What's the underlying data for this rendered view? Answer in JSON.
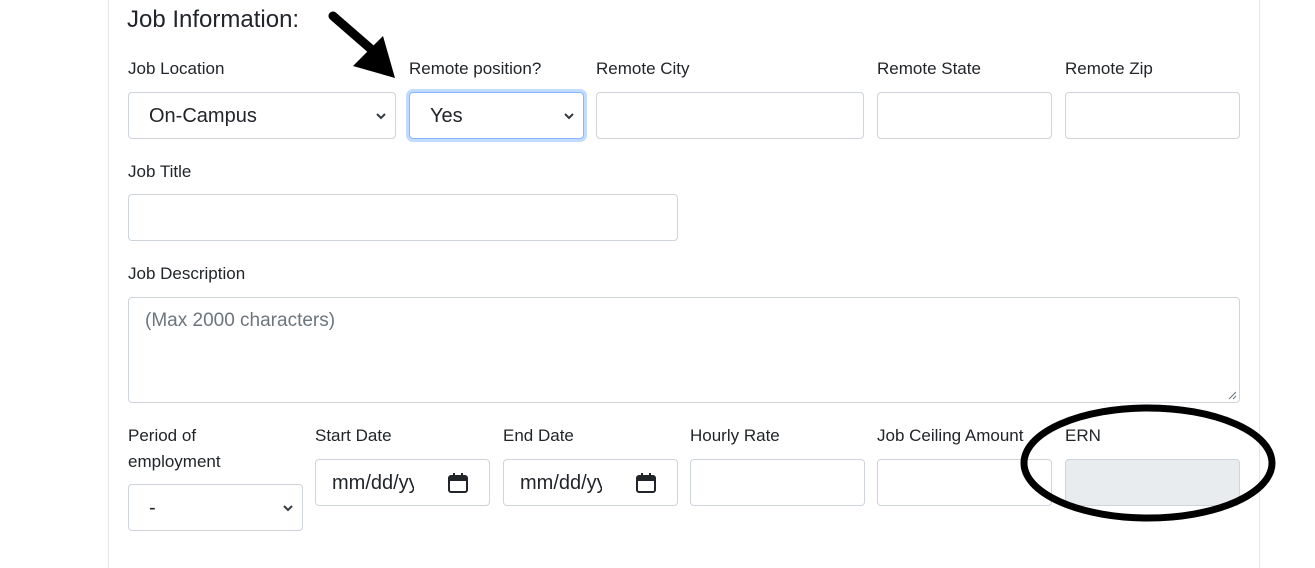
{
  "section": {
    "title": "Job Information:"
  },
  "row1": {
    "job_location": {
      "label": "Job Location",
      "value": "On-Campus"
    },
    "remote_position": {
      "label": "Remote position?",
      "value": "Yes"
    },
    "remote_city": {
      "label": "Remote City",
      "value": ""
    },
    "remote_state": {
      "label": "Remote State",
      "value": ""
    },
    "remote_zip": {
      "label": "Remote Zip",
      "value": ""
    }
  },
  "job_title": {
    "label": "Job Title",
    "value": ""
  },
  "job_description": {
    "label": "Job Description",
    "placeholder": "(Max 2000 characters)"
  },
  "row3": {
    "period": {
      "label_line1": "Period of",
      "label_line2": "employment",
      "value": "-"
    },
    "start_date": {
      "label": "Start Date",
      "value": "mm/dd/yyyy"
    },
    "end_date": {
      "label": "End Date",
      "value": "mm/dd/yyyy"
    },
    "hourly_rate": {
      "label": "Hourly Rate",
      "value": ""
    },
    "job_ceiling": {
      "label": "Job Ceiling Amount",
      "value": ""
    },
    "ern": {
      "label": "ERN",
      "value": ""
    }
  },
  "annotations": {
    "arrow_icon": "black-arrow",
    "circle_icon": "black-ellipse",
    "annotation_color": "#000000"
  },
  "colors": {
    "focus_border": "#86b7fe",
    "input_border": "#ced4da",
    "disabled_bg": "#e9ecef"
  }
}
